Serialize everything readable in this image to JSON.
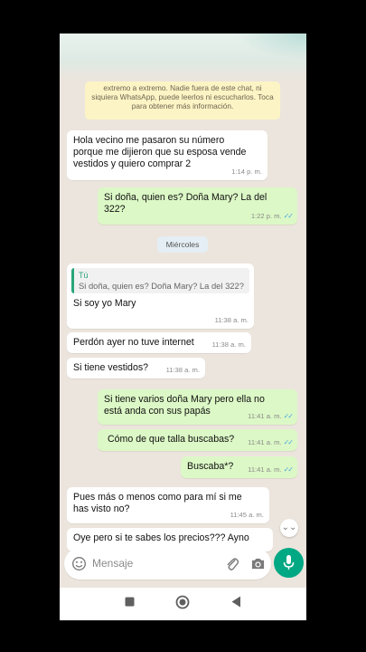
{
  "encryption_notice": "extremo a extremo. Nadie fuera de este chat, ni siquiera WhatsApp, puede leerlos ni escucharlos. Toca para obtener más información.",
  "messages": [
    {
      "text": "Hola vecino me pasaron su número porque me dijieron que su esposa vende vestidos y quiero comprar 2",
      "time": "1:14 p. m."
    },
    {
      "text": "Si doña, quien es? Doña Mary? La del 322?",
      "time": "1:22 p. m."
    },
    {
      "quote_author": "Tú",
      "quote_text": "Si doña, quien es? Doña Mary? La del 322?",
      "text": "Si soy yo Mary",
      "time": "11:38 a. m."
    },
    {
      "text": "Perdón ayer no tuve internet",
      "time": "11:38 a. m."
    },
    {
      "text": "Si tiene vestidos?",
      "time": "11:38 a. m."
    },
    {
      "text": "Si tiene varios doña Mary pero ella no está anda con sus papás",
      "time": "11:41 a. m."
    },
    {
      "text": "Cómo de que talla buscabas?",
      "time": "11:41 a. m."
    },
    {
      "text": "Buscaba*?",
      "time": "11:41 a. m."
    },
    {
      "text": "Pues más o menos como para mí si me has visto no?",
      "time": "11:45 a. m."
    },
    {
      "text": "Oye pero si te sabes los precios??? Ayno",
      "time": ""
    }
  ],
  "day_divider": "Miércoles",
  "composer": {
    "placeholder": "Mensaje"
  },
  "icons": {
    "emoji": "emoji-icon",
    "attach": "paperclip-icon",
    "camera": "camera-icon",
    "mic": "microphone-icon",
    "scroll": "double-chevron-down-icon",
    "read": "double-check-icon",
    "recents": "square-icon",
    "home": "circle-icon",
    "back": "triangle-back-icon"
  },
  "colors": {
    "background": "#ece5dd",
    "incoming": "#ffffff",
    "outgoing": "#dcf8c6",
    "accent": "#00a884",
    "read_ticks": "#4fa6e0"
  }
}
